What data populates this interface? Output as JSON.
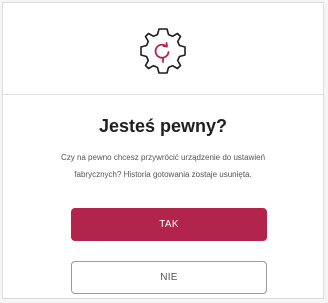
{
  "dialog": {
    "icon": "gear-reset-icon",
    "title": "Jesteś pewny?",
    "message_line1": "Czy na pewno chcesz przywrócić urządzenie do ustawień",
    "message_line2": "fabrycznych? Historia gotowania zostaje usunięta.",
    "confirm_label": "TAK",
    "cancel_label": "NIE"
  },
  "colors": {
    "accent": "#b3244c",
    "background": "#ffffff",
    "title_text": "#202020",
    "body_text": "#555555"
  }
}
